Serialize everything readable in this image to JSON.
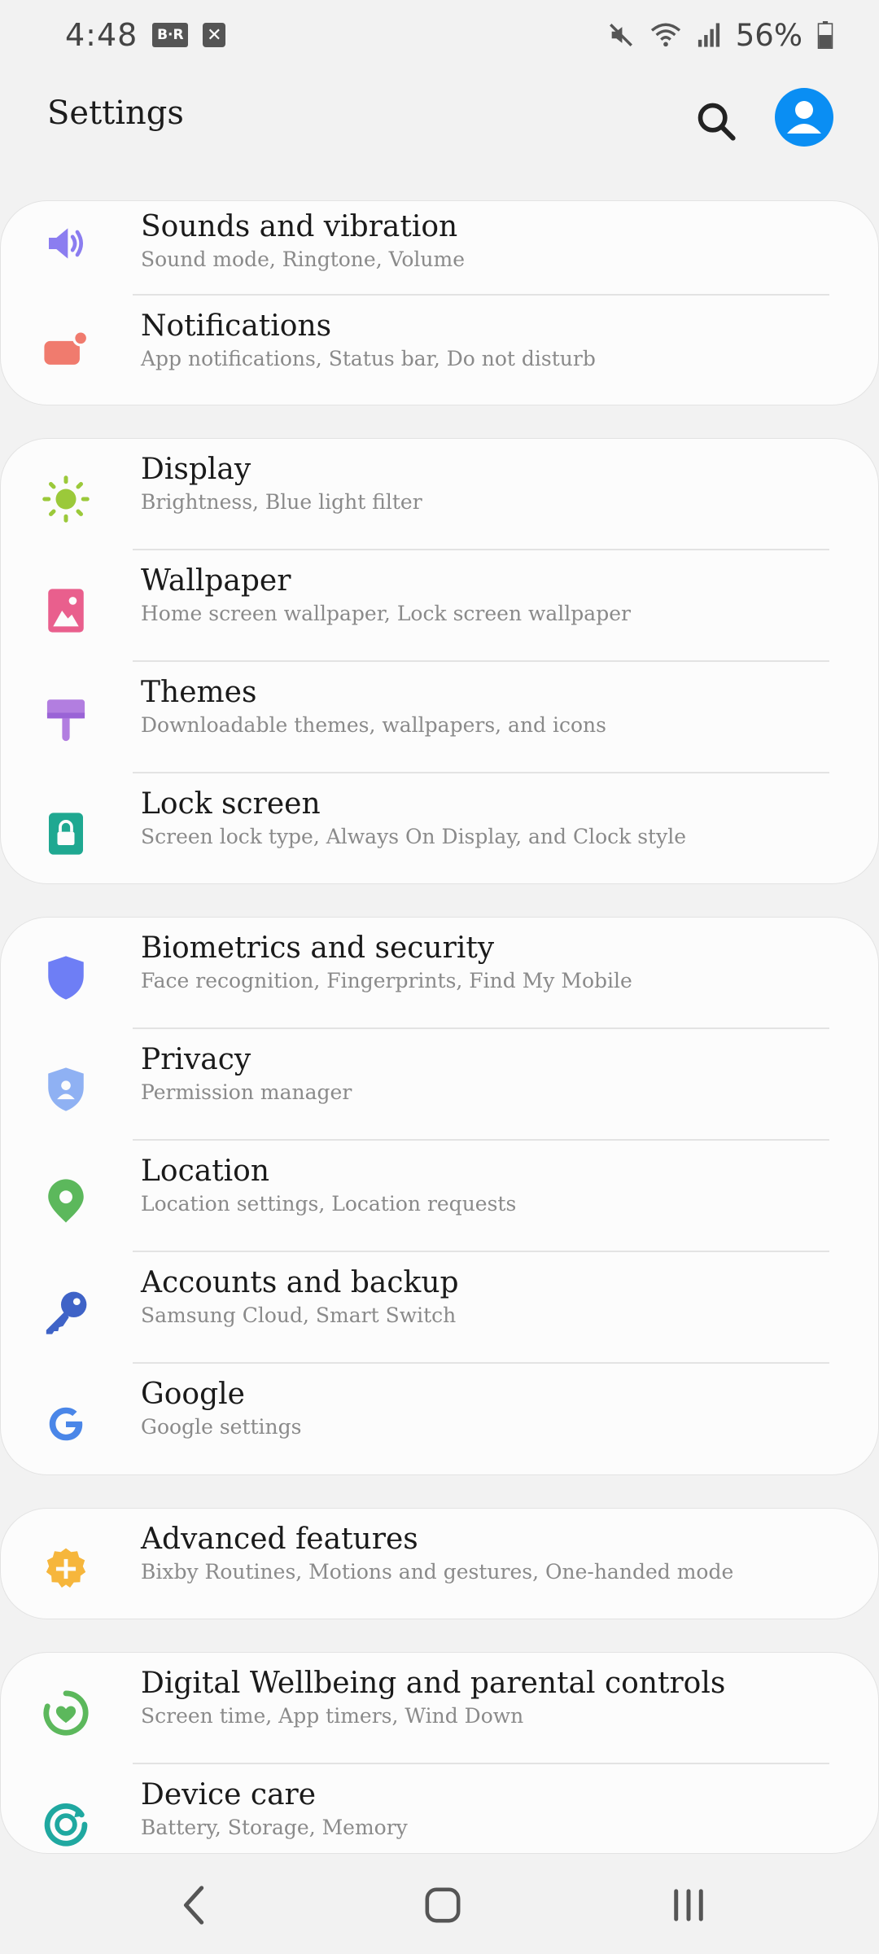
{
  "status_bar": {
    "time": "4:48",
    "badge_text": "B·R",
    "notif_x": "✕",
    "battery_percent": "56%"
  },
  "header": {
    "title": "Settings"
  },
  "groups": [
    {
      "items": [
        {
          "title": "Sounds and vibration",
          "subtitle": "Sound mode, Ringtone, Volume",
          "icon": "speaker-icon",
          "color": "#8b7df0"
        },
        {
          "title": "Notifications",
          "subtitle": "App notifications, Status bar, Do not disturb",
          "icon": "notification-icon",
          "color": "#f07b6e"
        }
      ]
    },
    {
      "items": [
        {
          "title": "Display",
          "subtitle": "Brightness, Blue light filter",
          "icon": "sun-icon",
          "color": "#9bc93a"
        },
        {
          "title": "Wallpaper",
          "subtitle": "Home screen wallpaper, Lock screen wallpaper",
          "icon": "wallpaper-icon",
          "color": "#e95f8d"
        },
        {
          "title": "Themes",
          "subtitle": "Downloadable themes, wallpapers, and icons",
          "icon": "brush-icon",
          "color": "#b27ee0"
        },
        {
          "title": "Lock screen",
          "subtitle": "Screen lock type, Always On Display, and Clock style",
          "icon": "lock-icon",
          "color": "#1fa891"
        }
      ]
    },
    {
      "items": [
        {
          "title": "Biometrics and security",
          "subtitle": "Face recognition, Fingerprints, Find My Mobile",
          "icon": "shield-icon",
          "color": "#6e7ef5"
        },
        {
          "title": "Privacy",
          "subtitle": "Permission manager",
          "icon": "privacy-shield-icon",
          "color": "#8fb1f3"
        },
        {
          "title": "Location",
          "subtitle": "Location settings, Location requests",
          "icon": "location-pin-icon",
          "color": "#5cb85c"
        },
        {
          "title": "Accounts and backup",
          "subtitle": "Samsung Cloud, Smart Switch",
          "icon": "key-icon",
          "color": "#3f63c7"
        },
        {
          "title": "Google",
          "subtitle": "Google settings",
          "icon": "google-icon",
          "color": "#4a86e8"
        }
      ]
    },
    {
      "items": [
        {
          "title": "Advanced features",
          "subtitle": "Bixby Routines, Motions and gestures, One-handed mode",
          "icon": "gear-plus-icon",
          "color": "#f6b63c"
        }
      ]
    },
    {
      "items": [
        {
          "title": "Digital Wellbeing and parental controls",
          "subtitle": "Screen time, App timers, Wind Down",
          "icon": "wellbeing-icon",
          "color": "#5cb85c"
        },
        {
          "title": "Device care",
          "subtitle": "Battery, Storage, Memory",
          "icon": "device-care-icon",
          "color": "#1fa8a0"
        }
      ]
    }
  ]
}
